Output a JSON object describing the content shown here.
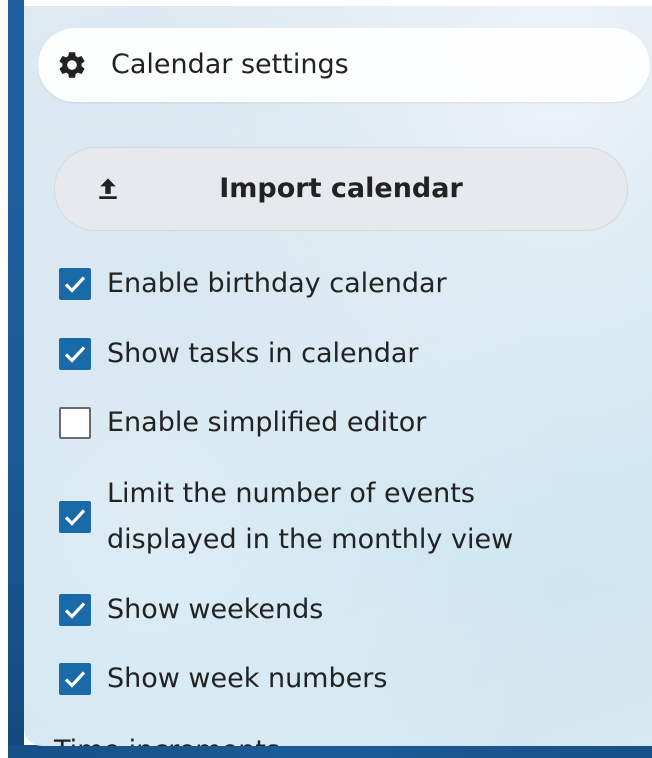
{
  "settings_button": {
    "label": "Calendar settings",
    "icon": "gear-icon"
  },
  "import_button": {
    "label": "Import calendar",
    "icon": "upload-icon"
  },
  "options": [
    {
      "label": "Enable birthday calendar",
      "checked": true
    },
    {
      "label": "Show tasks in calendar",
      "checked": true
    },
    {
      "label": "Enable simplified editor",
      "checked": false
    },
    {
      "label_line1": "Limit the number of events",
      "label_line2": "displayed in the monthly view",
      "checked": true
    },
    {
      "label": "Show weekends",
      "checked": true
    },
    {
      "label": "Show week numbers",
      "checked": true
    }
  ],
  "section": {
    "time_increments": "Time increments"
  },
  "colors": {
    "accent": "#1b6aa8",
    "panel_background": "#d2e5f0",
    "frame": "#1a5a96"
  }
}
